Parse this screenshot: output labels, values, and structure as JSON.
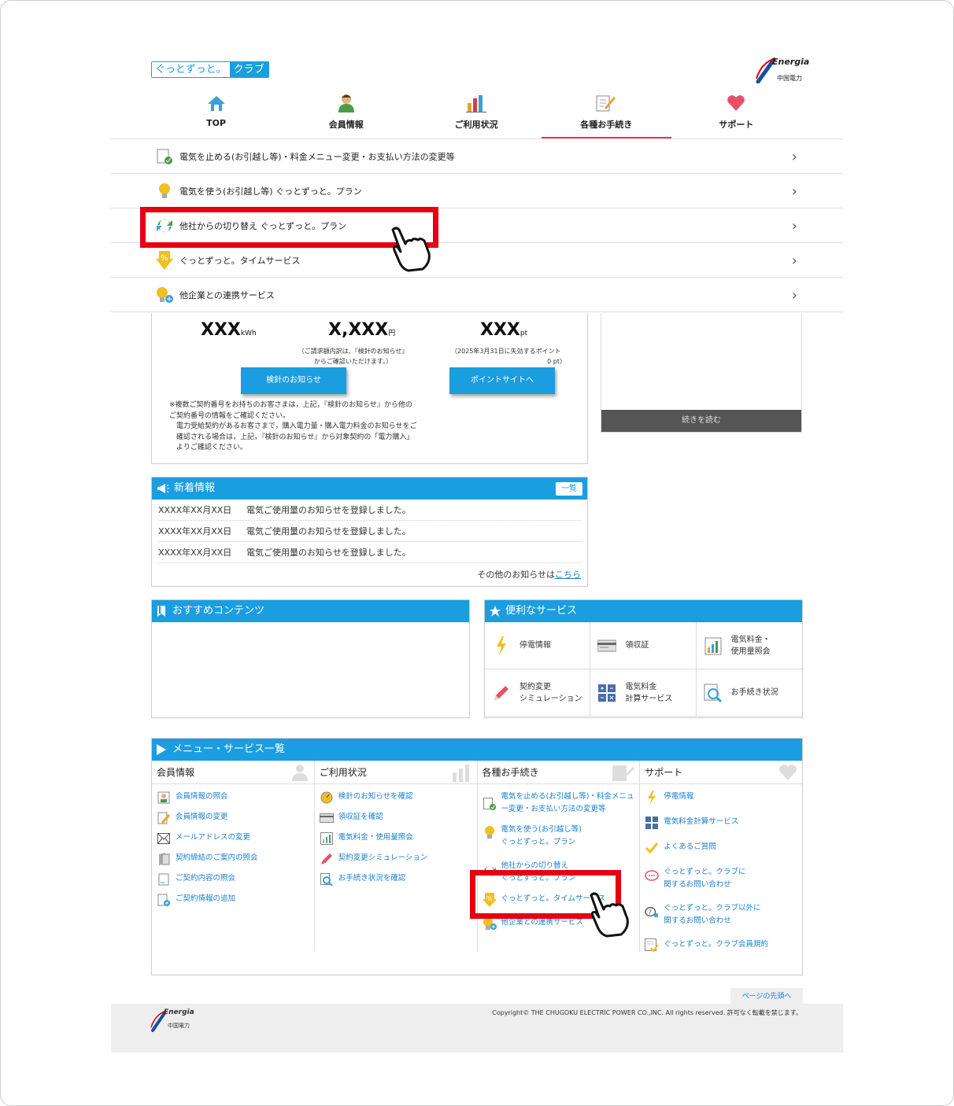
{
  "header": {
    "club_logo_a": "ぐっとずっと。",
    "club_logo_b": "クラブ",
    "energia_logo": "Energia",
    "energia_sub": "中国電力"
  },
  "nav": [
    {
      "label": "TOP",
      "icon": "home-icon"
    },
    {
      "label": "会員情報",
      "icon": "person-icon"
    },
    {
      "label": "ご利用状況",
      "icon": "bar-chart-icon"
    },
    {
      "label": "各種お手続き",
      "icon": "pencil-icon"
    },
    {
      "label": "サポート",
      "icon": "heart-icon"
    }
  ],
  "dropdown": [
    {
      "label": "電気を止める(お引越し等)・料金メニュー変更・お支払い方法の変更等",
      "icon": "document-check-icon"
    },
    {
      "label": "電気を使う(お引越し等) ぐっとずっと。プラン",
      "icon": "bulb-icon"
    },
    {
      "label": "他社からの切り替え ぐっとずっと。プラン",
      "icon": "switch-arrows-icon"
    },
    {
      "label": "ぐっとずっと。タイムサービス",
      "icon": "percent-arrow-icon"
    },
    {
      "label": "他企業との連携サービス",
      "icon": "bulb-plus-icon"
    }
  ],
  "summary": {
    "usage_value": "XXX",
    "usage_unit": "kWh",
    "bill_value": "X,XXX",
    "bill_unit": "円",
    "bill_note": "（ご請求額内訳は、『検針のお知らせ』からご確認いただけます。）",
    "points_value": "XXX",
    "points_unit": "pt",
    "points_note1": "（2025年3月31日に失効するポイント",
    "points_note2": "0 pt）",
    "meter_button": "検針のお知らせ",
    "point_button": "ポイントサイトへ",
    "footnote1": "※複数ご契約番号をお持ちのお客さまは，上記，『検針のお知らせ』から他のご契約番号の情報をご確認ください。",
    "footnote2": "電力受給契約があるお客さまで，購入電力量・購入電力料金のお知らせをご確認される場合は，上記，『検針のお知らせ』から対象契約の「電力購入」よりご確認ください。",
    "readmore": "続きを読む"
  },
  "news": {
    "title": "新着情報",
    "list_button": "一覧",
    "items": [
      {
        "date": "XXXX年XX月XX日",
        "text": "電気ご使用量のお知らせを登録しました。"
      },
      {
        "date": "XXXX年XX月XX日",
        "text": "電気ご使用量のお知らせを登録しました。"
      },
      {
        "date": "XXXX年XX月XX日",
        "text": "電気ご使用量のお知らせを登録しました。"
      }
    ],
    "more_prefix": "その他のお知らせは",
    "more_link": "こちら"
  },
  "recommend": {
    "title": "おすすめコンテンツ"
  },
  "services": {
    "title": "便利なサービス",
    "items": [
      {
        "label": "停電情報",
        "icon": "lightning-icon"
      },
      {
        "label": "領収証",
        "icon": "receipt-icon"
      },
      {
        "label": "電気料金・\n使用量照会",
        "icon": "chart-yen-icon"
      },
      {
        "label": "契約変更\nシミュレーション",
        "icon": "pencil-icon"
      },
      {
        "label": "電気料金\n計算サービス",
        "icon": "calculator-icon"
      },
      {
        "label": "お手続き状況",
        "icon": "magnifier-icon"
      }
    ]
  },
  "menu": {
    "title": "メニュー・サービス一覧",
    "columns": [
      {
        "title": "会員情報",
        "items": [
          "会員情報の照会",
          "会員情報の変更",
          "メールアドレスの変更",
          "契約締結のご案内の照会",
          "ご契約内容の照会",
          "ご契約情報の追加"
        ]
      },
      {
        "title": "ご利用状況",
        "items": [
          "検針のお知らせを確認",
          "領収証を確認",
          "電気料金・使用量照会",
          "契約変更シミュレーション",
          "お手続き状況を確認"
        ]
      },
      {
        "title": "各種お手続き",
        "items": [
          "電気を止める(お引越し等)・料金メニュー変更・お支払い方法の変更等",
          "電気を使う(お引越し等)\nぐっとずっと。プラン",
          "他社からの切り替え\nぐっとずっと。プラン",
          "ぐっとずっと。タイムサービス",
          "他企業との連携サービス"
        ]
      },
      {
        "title": "サポート",
        "items": [
          "停電情報",
          "電気料金計算サービス",
          "よくあるご質問",
          "ぐっとずっと。クラブに\n関するお問い合わせ",
          "ぐっとずっと。クラブ以外に\n関するお問い合わせ",
          "ぐっとずっと。クラブ会員規約"
        ]
      }
    ]
  },
  "footer": {
    "page_top": "ページの先頭へ",
    "copyright": "Copyright© THE CHUGOKU ELECTRIC POWER CO.,INC. All rights reserved. 許可なく転載を禁じます。",
    "logo": "Energia",
    "logo_sub": "中国電力"
  },
  "colors": {
    "accent": "#1a9ee0",
    "highlight": "#e60012",
    "active_tab": "#e0395a"
  }
}
